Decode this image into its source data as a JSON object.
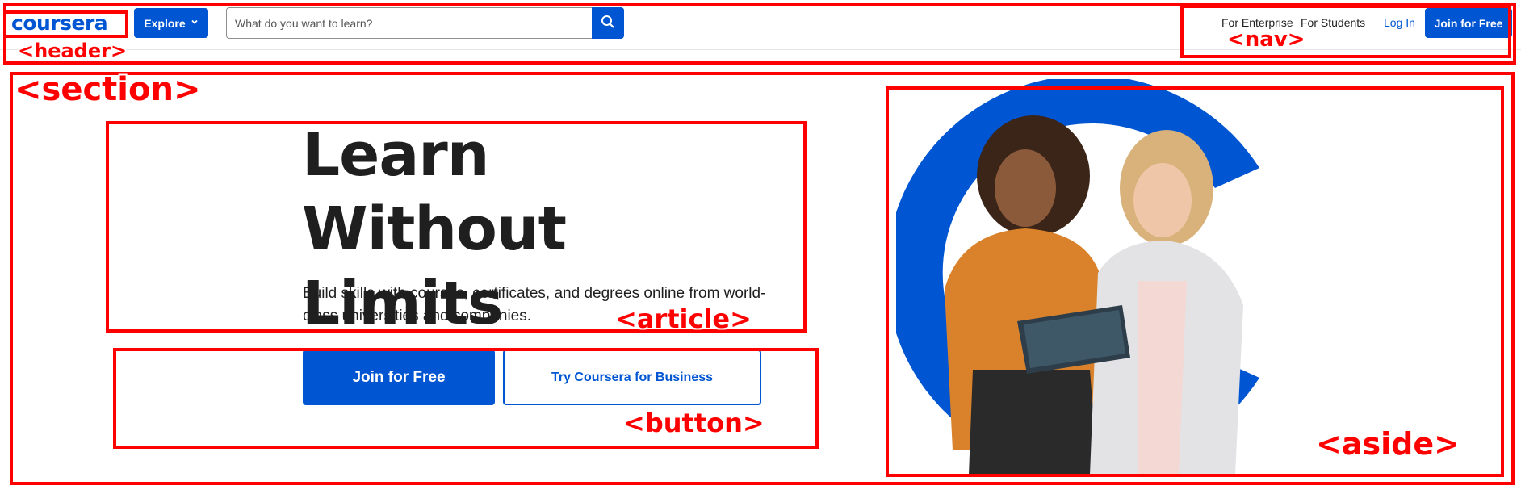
{
  "header": {
    "logo_text": "coursera",
    "explore_label": "Explore",
    "search_placeholder": "What do you want to learn?"
  },
  "nav": {
    "enterprise": "For Enterprise",
    "students": "For Students",
    "login": "Log In",
    "join": "Join for Free"
  },
  "hero": {
    "title_line1": "Learn Without",
    "title_line2": "Limits",
    "subtitle": "Build skills with courses, certificates, and degrees online from world-class universities and companies.",
    "primary_button": "Join for Free",
    "secondary_button": "Try Coursera for Business"
  },
  "annotations": {
    "header": "<header>",
    "nav": "<nav>",
    "section": "<section>",
    "article": "<article>",
    "button": "<button>",
    "aside": "<aside>"
  },
  "colors": {
    "brand": "#0056d2",
    "annotation": "#ff0000",
    "text": "#1f1f1f"
  }
}
